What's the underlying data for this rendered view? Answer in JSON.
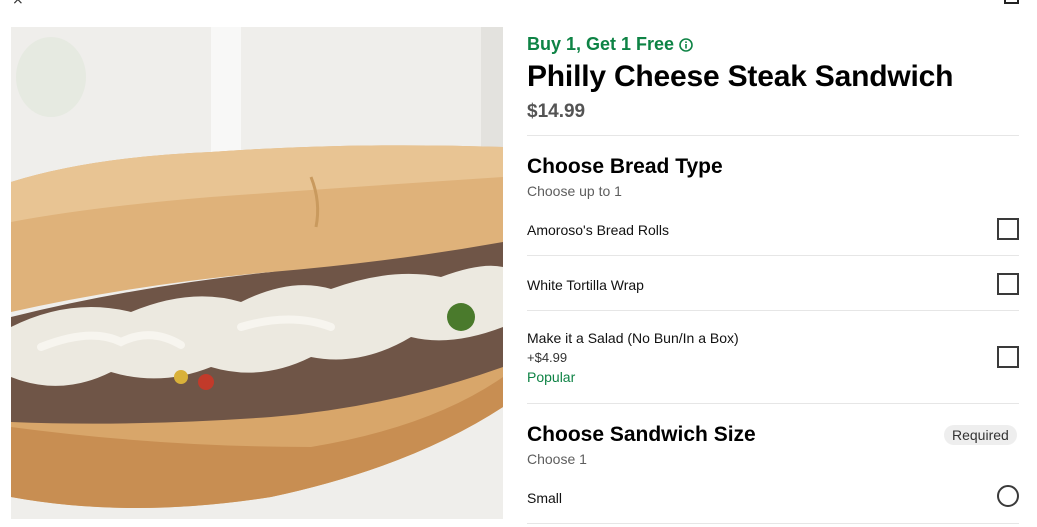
{
  "top": {
    "close_glyph": "×"
  },
  "item": {
    "promo": "Buy 1, Get 1 Free",
    "title": "Philly Cheese Steak Sandwich",
    "price": "$14.99"
  },
  "bread_section": {
    "title": "Choose Bread Type",
    "subtitle": "Choose up to 1",
    "options": [
      {
        "label": "Amoroso's Bread Rolls"
      },
      {
        "label": "White Tortilla Wrap"
      },
      {
        "label": "Make it a Salad (No Bun/In a Box)",
        "price": "+$4.99",
        "tag": "Popular"
      }
    ]
  },
  "size_section": {
    "title": "Choose Sandwich Size",
    "subtitle": "Choose 1",
    "badge": "Required",
    "options": [
      {
        "label": "Small"
      }
    ]
  },
  "colors": {
    "promo_green": "#0e8345",
    "text": "#000000",
    "muted": "#5e5e5e"
  },
  "icons": [
    "close-icon",
    "info-icon",
    "checkbox-icon",
    "radio-icon"
  ]
}
